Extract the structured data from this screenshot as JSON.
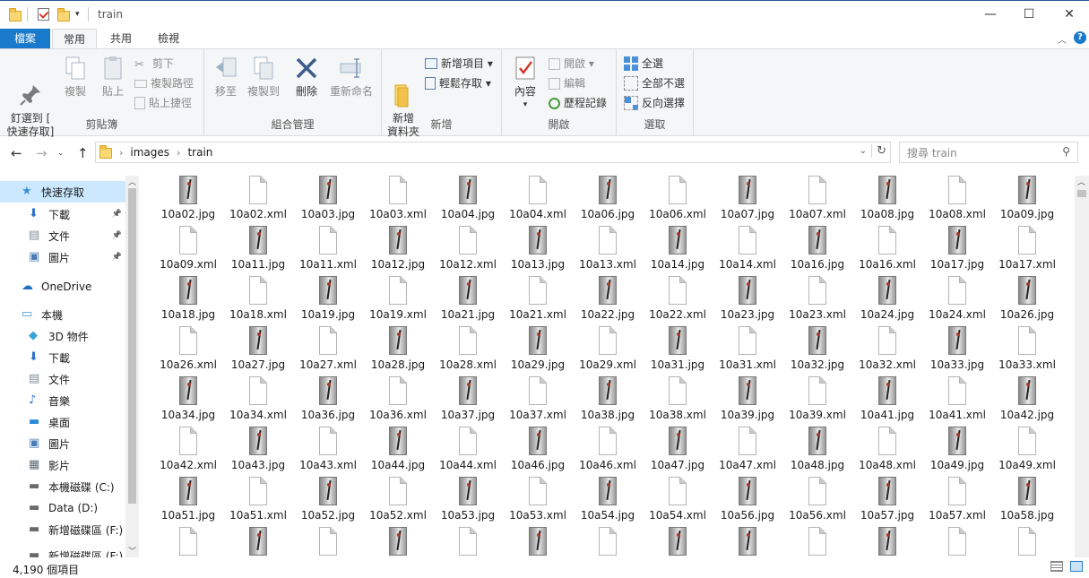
{
  "window": {
    "title": "train",
    "controls": [
      "—",
      "☐",
      "✕"
    ]
  },
  "ribbon_tabs": [
    "檔案",
    "常用",
    "共用",
    "檢視"
  ],
  "ribbon": {
    "clipboard": {
      "label": "剪貼簿",
      "pin": "釘選到 [\n快速存取]",
      "copy": "複製",
      "paste": "貼上",
      "cut": "剪下",
      "copy_path": "複製路徑",
      "paste_shortcut": "貼上捷徑"
    },
    "organize": {
      "label": "組合管理",
      "move_to": "移至",
      "copy_to": "複製到",
      "delete": "刪除",
      "rename": "重新命名"
    },
    "new": {
      "label": "新增",
      "new_folder": "新增\n資料夾",
      "new_item": "新增項目 ▾",
      "easy_access": "輕鬆存取 ▾"
    },
    "open": {
      "label": "開啟",
      "properties": "內容",
      "open": "開啟 ▾",
      "edit": "編輯",
      "history": "歷程記錄"
    },
    "select": {
      "label": "選取",
      "select_all": "全選",
      "select_none": "全部不選",
      "invert": "反向選擇"
    }
  },
  "address": {
    "crumbs": [
      "images",
      "train"
    ],
    "search_placeholder": "搜尋 train"
  },
  "nav_items": [
    {
      "label": "快速存取",
      "icon": "star-icon",
      "indent": 1,
      "selected": true,
      "pinned": false
    },
    {
      "label": "下載",
      "icon": "download-icon",
      "indent": 2,
      "selected": false,
      "pinned": true
    },
    {
      "label": "文件",
      "icon": "document-icon",
      "indent": 2,
      "selected": false,
      "pinned": true
    },
    {
      "label": "圖片",
      "icon": "picture-icon",
      "indent": 2,
      "selected": false,
      "pinned": true
    },
    {
      "label": "OneDrive",
      "icon": "cloud-icon",
      "indent": 1,
      "selected": false,
      "pinned": false
    },
    {
      "label": "本機",
      "icon": "computer-icon",
      "indent": 1,
      "selected": false,
      "pinned": false
    },
    {
      "label": "3D 物件",
      "icon": "cube-icon",
      "indent": 2,
      "selected": false,
      "pinned": false
    },
    {
      "label": "下載",
      "icon": "download-icon",
      "indent": 2,
      "selected": false,
      "pinned": false
    },
    {
      "label": "文件",
      "icon": "document-icon",
      "indent": 2,
      "selected": false,
      "pinned": false
    },
    {
      "label": "音樂",
      "icon": "music-icon",
      "indent": 2,
      "selected": false,
      "pinned": false
    },
    {
      "label": "桌面",
      "icon": "desktop-icon",
      "indent": 2,
      "selected": false,
      "pinned": false
    },
    {
      "label": "圖片",
      "icon": "picture-icon",
      "indent": 2,
      "selected": false,
      "pinned": false
    },
    {
      "label": "影片",
      "icon": "video-icon",
      "indent": 2,
      "selected": false,
      "pinned": false
    },
    {
      "label": "本機磁碟 (C:)",
      "icon": "drive-icon",
      "indent": 2,
      "selected": false,
      "pinned": false
    },
    {
      "label": "Data (D:)",
      "icon": "drive-icon",
      "indent": 2,
      "selected": false,
      "pinned": false
    },
    {
      "label": "新增磁碟區 (F:)",
      "icon": "drive-icon",
      "indent": 2,
      "selected": false,
      "pinned": false
    },
    {
      "label": "新增磁碟區 (F:)",
      "icon": "drive-icon",
      "indent": 2,
      "selected": false,
      "pinned": false
    }
  ],
  "files": [
    "10a02.jpg",
    "10a02.xml",
    "10a03.jpg",
    "10a03.xml",
    "10a04.jpg",
    "10a04.xml",
    "10a06.jpg",
    "10a06.xml",
    "10a07.jpg",
    "10a07.xml",
    "10a08.jpg",
    "10a08.xml",
    "10a09.jpg",
    "10a09.xml",
    "10a11.jpg",
    "10a11.xml",
    "10a12.jpg",
    "10a12.xml",
    "10a13.jpg",
    "10a13.xml",
    "10a14.jpg",
    "10a14.xml",
    "10a16.jpg",
    "10a16.xml",
    "10a17.jpg",
    "10a17.xml",
    "10a18.jpg",
    "10a18.xml",
    "10a19.jpg",
    "10a19.xml",
    "10a21.jpg",
    "10a21.xml",
    "10a22.jpg",
    "10a22.xml",
    "10a23.jpg",
    "10a23.xml",
    "10a24.jpg",
    "10a24.xml",
    "10a26.jpg",
    "10a26.xml",
    "10a27.jpg",
    "10a27.xml",
    "10a28.jpg",
    "10a28.xml",
    "10a29.jpg",
    "10a29.xml",
    "10a31.jpg",
    "10a31.xml",
    "10a32.jpg",
    "10a32.xml",
    "10a33.jpg",
    "10a33.xml",
    "10a34.jpg",
    "10a34.xml",
    "10a36.jpg",
    "10a36.xml",
    "10a37.jpg",
    "10a37.xml",
    "10a38.jpg",
    "10a38.xml",
    "10a39.jpg",
    "10a39.xml",
    "10a41.jpg",
    "10a41.xml",
    "10a42.jpg",
    "10a42.xml",
    "10a43.jpg",
    "10a43.xml",
    "10a44.jpg",
    "10a44.xml",
    "10a46.jpg",
    "10a46.xml",
    "10a47.jpg",
    "10a47.xml",
    "10a48.jpg",
    "10a48.xml",
    "10a49.jpg",
    "10a49.xml",
    "10a51.jpg",
    "10a51.xml",
    "10a52.jpg",
    "10a52.xml",
    "10a53.jpg",
    "10a53.xml",
    "10a54.jpg",
    "10a54.xml",
    "10a56.jpg",
    "10a56.xml",
    "10a57.jpg",
    "10a57.xml",
    "10a58.jpg"
  ],
  "partial_row_types": [
    "xml",
    "jpg",
    "xml",
    "jpg",
    "xml",
    "jpg",
    "xml",
    "jpg",
    "jpg",
    "xml",
    "jpg",
    "xml",
    "xml"
  ],
  "status": {
    "count": "4,190 個項目"
  }
}
